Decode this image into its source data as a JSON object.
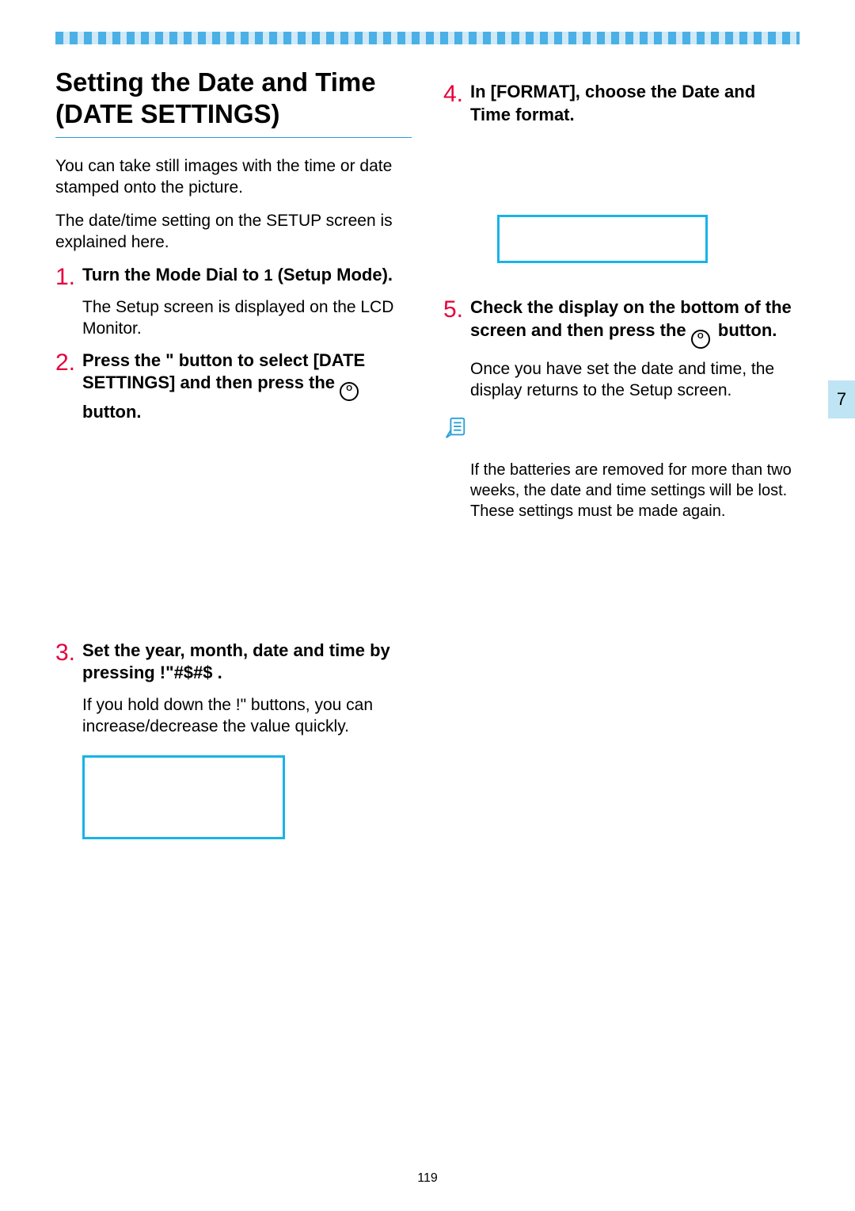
{
  "title": "Setting the Date and Time (DATE SETTINGS)",
  "intro": {
    "p1": "You can take still images with the time or date stamped onto the picture.",
    "p2": "The date/time setting on the SETUP screen is explained here."
  },
  "steps": {
    "s1": {
      "num": "1.",
      "head_pre": "Turn the Mode Dial to ",
      "head_sym": "1",
      "head_post": " (Setup Mode).",
      "desc": "The Setup screen is displayed on the LCD Monitor."
    },
    "s2": {
      "num": "2.",
      "head_pre": "Press the \" button to select [DATE SETTINGS] and then press the ",
      "ok": "O",
      "head_post": " button."
    },
    "s3": {
      "num": "3.",
      "head": "Set the year, month, date and time by pressing !\"#$#$ .",
      "desc": "If you hold down the !\"  buttons, you can increase/decrease the value quickly."
    },
    "s4": {
      "num": "4.",
      "head": "In [FORMAT], choose the Date and Time format."
    },
    "s5": {
      "num": "5.",
      "head_pre": "Check the display on the bottom of the screen and then press the ",
      "ok": "O",
      "head_post": " button.",
      "desc": "Once you have set the date and time, the display returns to the Setup screen."
    }
  },
  "note": "If the batteries are removed for more than two weeks, the date and time settings will be lost. These settings must be made again.",
  "side_tab": "7",
  "page_number": "119"
}
